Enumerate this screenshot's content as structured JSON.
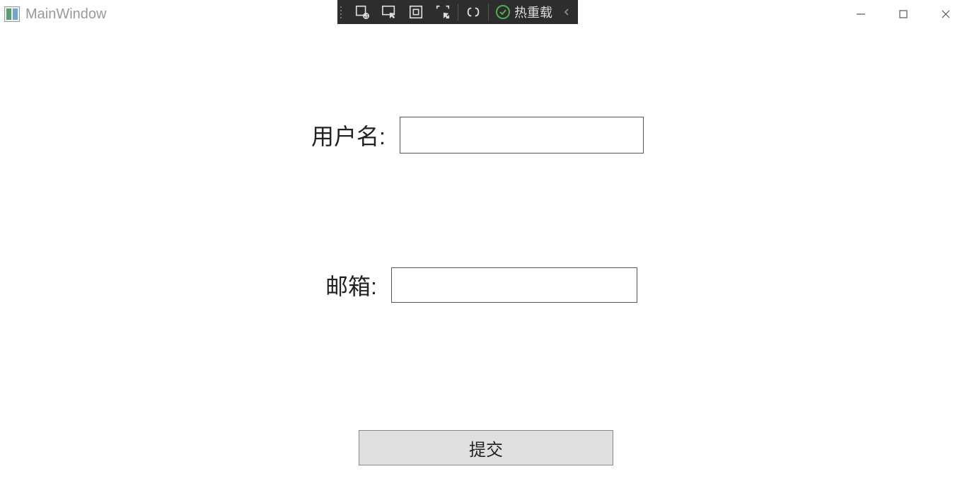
{
  "window": {
    "title": "MainWindow"
  },
  "debug_toolbar": {
    "hot_reload_label": "热重载"
  },
  "form": {
    "username_label": "用户名:",
    "username_value": "",
    "email_label": "邮箱:",
    "email_value": "",
    "submit_label": "提交"
  }
}
